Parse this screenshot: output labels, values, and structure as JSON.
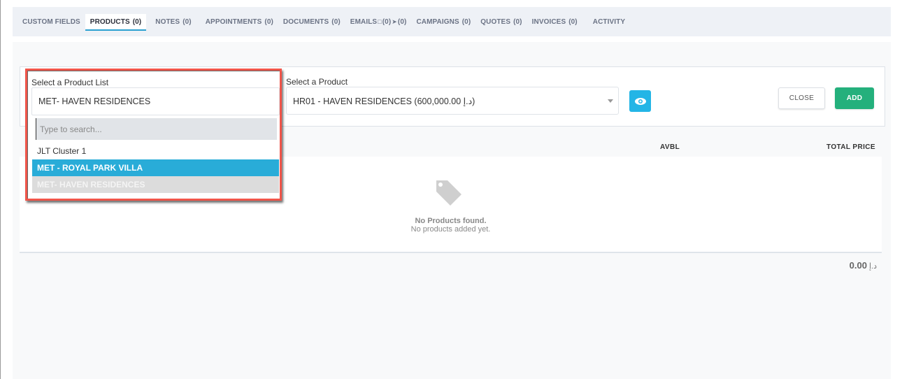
{
  "tabs": [
    {
      "label": "CUSTOM FIELDS",
      "count": "",
      "active": false
    },
    {
      "label": "PRODUCTS",
      "count": "(0)",
      "active": true
    },
    {
      "label": "NOTES",
      "count": "(0)",
      "active": false
    },
    {
      "label": "APPOINTMENTS",
      "count": "(0)",
      "active": false
    },
    {
      "label": "DOCUMENTS",
      "count": "(0)",
      "active": false
    },
    {
      "label": "EMAILS",
      "count_in": "(0)",
      "count_out": "(0)",
      "active": false
    },
    {
      "label": "CAMPAIGNS",
      "count": "(0)",
      "active": false
    },
    {
      "label": "QUOTES",
      "count": "(0)",
      "active": false
    },
    {
      "label": "INVOICES",
      "count": "(0)",
      "active": false
    },
    {
      "label": "ACTIVITY",
      "count": "",
      "active": false
    }
  ],
  "form": {
    "product_list_label": "Select a Product List",
    "product_list_value": "MET- HAVEN RESIDENCES",
    "product_label": "Select a Product",
    "product_value": "HR01 - HAVEN RESIDENCES (600,000.00 د.إ)",
    "close_label": "CLOSE",
    "add_label": "ADD"
  },
  "dropdown": {
    "search_placeholder": "Type to search...",
    "options": [
      {
        "label": "JLT Cluster 1",
        "state": "normal"
      },
      {
        "label": "MET - ROYAL PARK VILLA",
        "state": "hovered"
      },
      {
        "label": "MET- HAVEN RESIDENCES",
        "state": "selected"
      }
    ]
  },
  "table": {
    "columns": [
      "AVBL",
      "TOTAL PRICE"
    ],
    "empty_title": "No Products found.",
    "empty_subtitle": "No products added yet."
  },
  "total": {
    "amount": "0.00",
    "currency": "د.إ"
  },
  "colors": {
    "accent": "#29acd8",
    "add_green": "#24b07c",
    "highlight_red": "#f0554a"
  }
}
